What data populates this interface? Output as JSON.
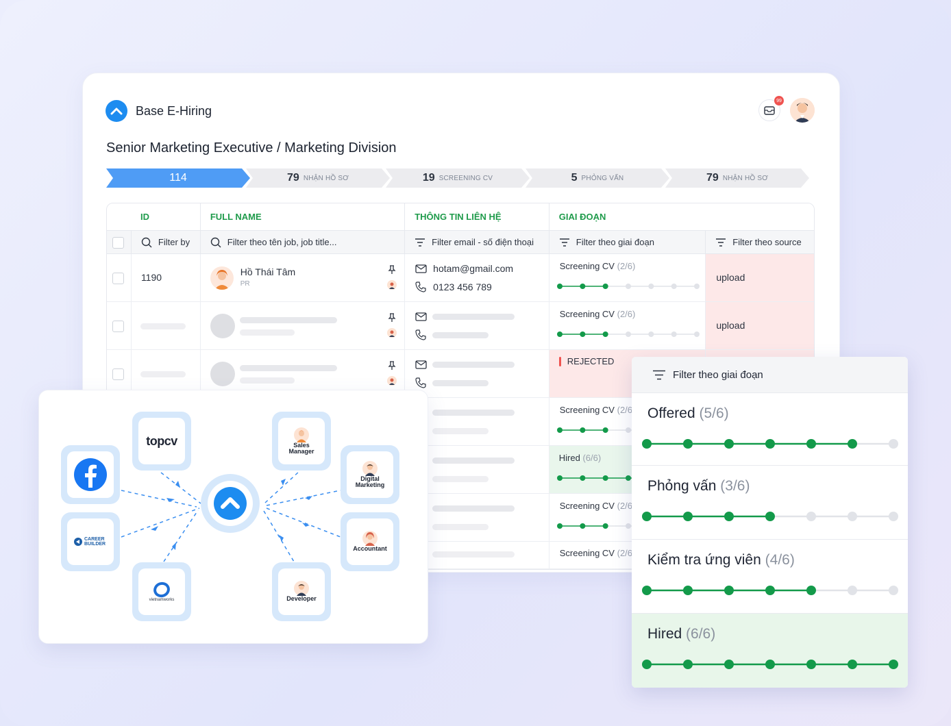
{
  "app": {
    "brand_name": "Base E-Hiring",
    "notification_count": "99",
    "page_title": "Senior Marketing Executive / Marketing Division",
    "pipeline": [
      {
        "count": "114",
        "label": ""
      },
      {
        "count": "79",
        "label": "NHẬN HỒ SƠ"
      },
      {
        "count": "19",
        "label": "SCREENING CV"
      },
      {
        "count": "5",
        "label": "PHỎNG VẤN"
      },
      {
        "count": "79",
        "label": "NHẬN HỒ SƠ"
      }
    ],
    "columns": {
      "id": "ID",
      "full_name": "FULL NAME",
      "contact": "THÔNG TIN LIÊN HỆ",
      "stage": "GIAI ĐOẠN"
    },
    "filters": {
      "id": "Filter by",
      "name": "Filter theo tên job, job title...",
      "contact": "Filter email - số điện thoại",
      "stage": "Filter theo giai đoạn",
      "source": "Filter theo source"
    },
    "rows": [
      {
        "id": "1190",
        "name": "Hồ Thái Tâm",
        "role": "PR",
        "email": "hotam@gmail.com",
        "phone": "0123 456 789",
        "stage": "Screening CV",
        "fraction": "(2/6)",
        "progress": 2,
        "source": "upload"
      },
      {
        "stage": "Screening CV",
        "fraction": "(2/6)",
        "progress": 2,
        "source": "upload"
      },
      {
        "stage": "REJECTED"
      },
      {
        "stage": "Screening CV",
        "fraction": "(2/6)",
        "progress": 2
      },
      {
        "stage": "Hired",
        "fraction": "(6/6)",
        "progress": 6
      },
      {
        "stage": "Screening CV",
        "fraction": "(2/6)",
        "progress": 2
      },
      {
        "stage": "Screening CV",
        "fraction": "(2/6)",
        "progress": 2
      }
    ]
  },
  "integrations": {
    "sources": [
      {
        "name": "facebook-icon",
        "label": ""
      },
      {
        "name": "topcv-logo",
        "label": "topcv"
      },
      {
        "name": "careerbuilder-logo",
        "label": "CAREER BUILDER"
      },
      {
        "name": "vietnamworks-logo",
        "label": "vietnamworks"
      }
    ],
    "destinations": [
      {
        "name": "sales-manager",
        "label": "Sales Manager"
      },
      {
        "name": "digital-marketing",
        "label": "Digital Marketing"
      },
      {
        "name": "accountant",
        "label": "Accountant"
      },
      {
        "name": "developer",
        "label": "Developer"
      }
    ]
  },
  "popup": {
    "title": "Filter theo giai đoạn",
    "items": [
      {
        "label": "Offered",
        "fraction": "(5/6)",
        "progress": 5
      },
      {
        "label": "Phỏng vấn",
        "fraction": "(3/6)",
        "progress": 3
      },
      {
        "label": "Kiểm tra ứng viên",
        "fraction": "(4/6)",
        "progress": 4
      },
      {
        "label": "Hired",
        "fraction": "(6/6)",
        "progress": 6
      }
    ]
  },
  "colors": {
    "accent": "#1d8cf0",
    "success": "#139a4a",
    "pipeline_active": "#4f9cf5",
    "rejected": "#ef5350"
  }
}
